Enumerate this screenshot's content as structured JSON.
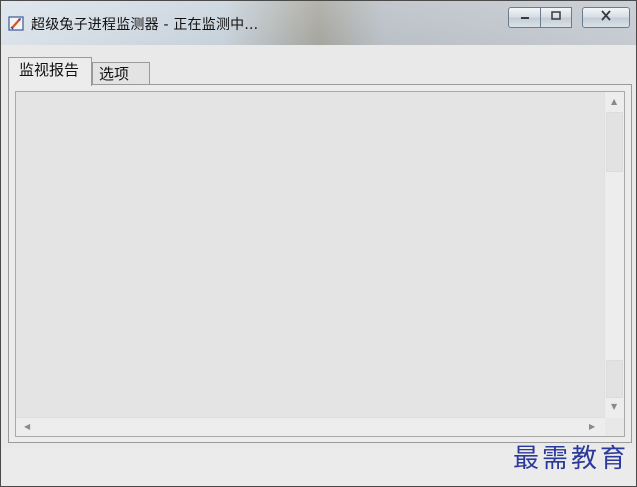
{
  "window": {
    "title": "超级兔子进程监测器 - 正在监测中..."
  },
  "title_controls": {
    "minimize_icon": "minimize-icon",
    "maximize_icon": "maximize-icon",
    "close_icon": "close-icon"
  },
  "tabs": [
    {
      "label": "监视报告",
      "active": true
    },
    {
      "label": "选项",
      "active": false
    }
  ],
  "report": {
    "content": ""
  },
  "watermark": {
    "text": "最需教育"
  },
  "colors": {
    "watermark": "#2b3a9a",
    "window_bg": "#e9e9e9",
    "textarea_bg": "#e4e4e4"
  }
}
